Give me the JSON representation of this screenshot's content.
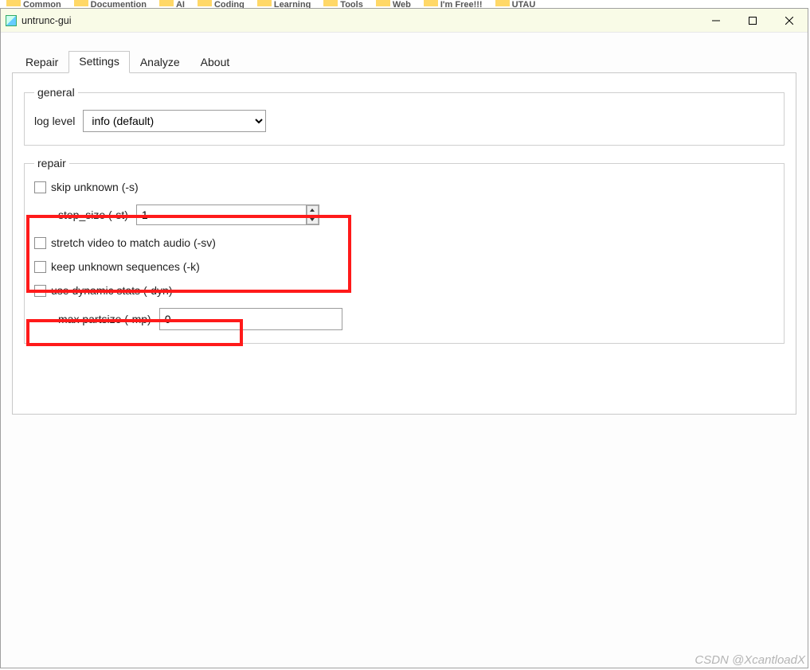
{
  "explorer_bg_tabs": [
    "Common",
    "Documention",
    "AI",
    "Coding",
    "Learning",
    "Tools",
    "Web",
    "I'm Free!!!",
    "UTAU"
  ],
  "window": {
    "title": "untrunc-gui"
  },
  "tabs": {
    "repair": "Repair",
    "settings": "Settings",
    "analyze": "Analyze",
    "about": "About",
    "active": "settings"
  },
  "groups": {
    "general": {
      "legend": "general",
      "loglevel_label": "log level",
      "loglevel_value": "info (default)"
    },
    "repair": {
      "legend": "repair",
      "skip_unknown_label": "skip unknown (-s)",
      "skip_unknown_checked": false,
      "step_size_label": "step_size (-st)",
      "step_size_value": "1",
      "stretch_label": "stretch video to match audio (-sv)",
      "stretch_checked": false,
      "keep_unknown_label": "keep unknown sequences (-k)",
      "keep_unknown_checked": false,
      "dyn_label": "use dynamic stats (-dyn)",
      "dyn_checked": false,
      "max_partsize_label": "max partsize (-mp)",
      "max_partsize_value": "0"
    }
  },
  "watermark": "CSDN @XcantloadX"
}
